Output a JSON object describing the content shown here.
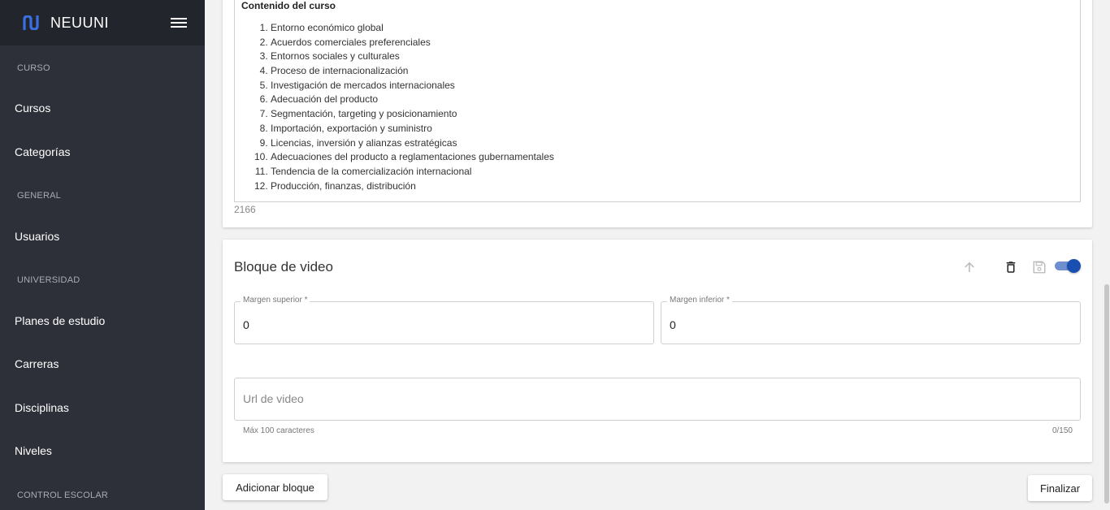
{
  "sidebar": {
    "brand": "NEUUNI",
    "sections": {
      "curso": "CURSO",
      "general": "GENERAL",
      "universidad": "UNIVERSIDAD",
      "control_escolar": "CONTROL ESCOLAR"
    },
    "items": {
      "cursos": "Cursos",
      "categorias": "Categorías",
      "usuarios": "Usuarios",
      "planes": "Planes de estudio",
      "carreras": "Carreras",
      "disciplinas": "Disciplinas",
      "niveles": "Niveles"
    },
    "colors": {
      "background": "#2d3039",
      "header": "#22252c",
      "logo": "#3b6fe0"
    }
  },
  "text_block": {
    "heading": "Contenido del curso",
    "list": [
      "Entorno económico global",
      "Acuerdos comerciales preferenciales",
      "Entornos sociales y culturales",
      "Proceso de internacionalización",
      "Investigación de mercados internacionales",
      "Adecuación del producto",
      "Segmentación, targeting y posicionamiento",
      "Importación, exportación y suministro",
      "Licencias, inversión y alianzas estratégicas",
      "Adecuaciones del producto a reglamentaciones gubernamentales",
      "Tendencia de la comercialización internacional",
      "Producción, finanzas, distribución"
    ],
    "char_count": "2166"
  },
  "video_block": {
    "title": "Bloque de video",
    "icons": [
      "arrow-up-icon",
      "trash-icon",
      "save-icon"
    ],
    "toggle_on": true,
    "margin_top": {
      "label": "Margen superior *",
      "value": "0"
    },
    "margin_bottom": {
      "label": "Margen inferior *",
      "value": "0"
    },
    "url": {
      "placeholder": "Url de video",
      "value": "",
      "hint": "Máx 100 caracteres",
      "counter": "0/150"
    },
    "colors": {
      "accent": "#1a4fb2"
    }
  },
  "actions": {
    "add_block": "Adicionar bloque",
    "finish": "Finalizar"
  }
}
